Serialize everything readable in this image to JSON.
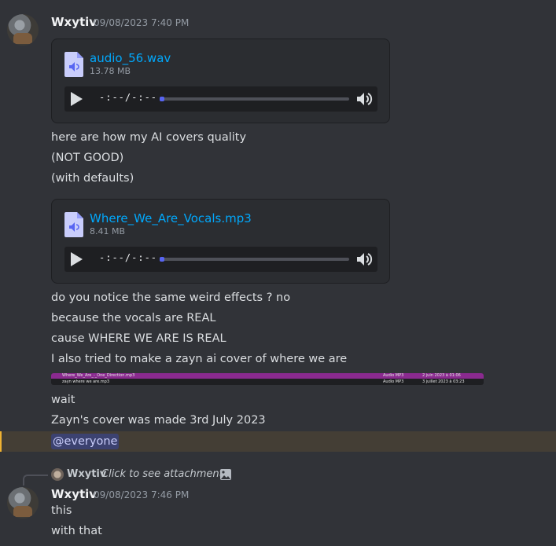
{
  "message1": {
    "username": "Wxytiv",
    "timestamp": "09/08/2023 7:40 PM",
    "attachment1": {
      "file_name": "audio_56.wav",
      "file_size": "13.78 MB",
      "time_display": "-:--/-:--",
      "progress": 0
    },
    "lines_a": [
      "here are how my AI covers quality",
      "(NOT GOOD)",
      "(with defaults)"
    ],
    "attachment2": {
      "file_name": "Where_We_Are_Vocals.mp3",
      "file_size": "8.41 MB",
      "time_display": "-:--/-:--",
      "progress": 0
    },
    "lines_b": [
      "do you notice the same weird effects ? no",
      "because the vocals are REAL",
      "cause WHERE WE ARE IS REAL",
      "I also tried to make a zayn ai cover of where we are"
    ],
    "image_rows": [
      {
        "name": "Where_We_Are_-_One_Direction.mp3",
        "kind": "Audio MP3",
        "date": "2 juin 2023 à 01:06"
      },
      {
        "name": "zayn where we are.mp3",
        "kind": "Audio MP3",
        "date": "3 juillet 2023 à 03:23"
      }
    ],
    "lines_c": [
      "wait",
      "Zayn's cover was made 3rd July 2023"
    ],
    "mention": "@everyone"
  },
  "reply": {
    "username": "Wxytiv",
    "text": "Click to see attachment"
  },
  "message2": {
    "username": "Wxytiv",
    "timestamp": "09/08/2023 7:46 PM",
    "lines": [
      "this",
      "with that"
    ]
  },
  "colors": {
    "background": "#313338",
    "link": "#00a8fc",
    "mention_bg": "#3c4270",
    "highlight_row": "#443e35",
    "accent": "#5865f2"
  }
}
